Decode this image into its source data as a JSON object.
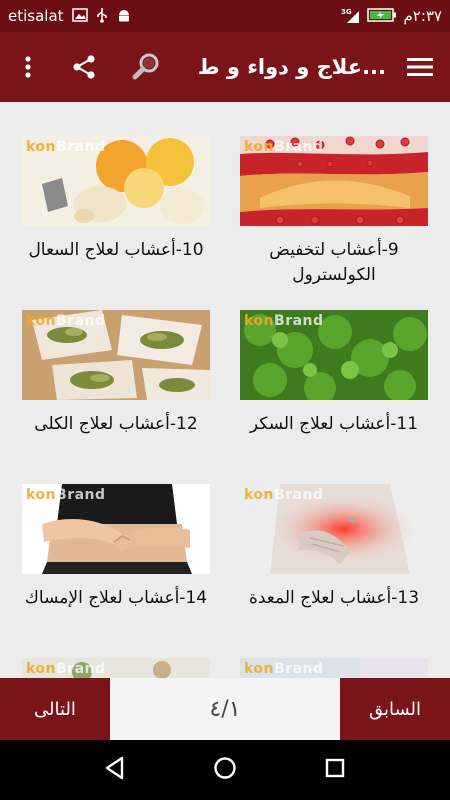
{
  "status_bar": {
    "carrier": "etisalat",
    "network": "3G",
    "time": "٢:٣٧م"
  },
  "app_bar": {
    "title": "علاج و دواء و ط..."
  },
  "items": [
    {
      "title": "9-أعشاب لتخفيض الكولسترول",
      "thumb": "cholesterol-artery"
    },
    {
      "title": "10-أعشاب لعلاج السعال",
      "thumb": "lemon-garlic"
    },
    {
      "title": "11-أعشاب لعلاج السكر",
      "thumb": "parsley"
    },
    {
      "title": "12-أعشاب لعلاج الكلى",
      "thumb": "dried-herbs"
    },
    {
      "title": "13-أعشاب لعلاج المعدة",
      "thumb": "stomach-pain"
    },
    {
      "title": "14-أعشاب لعلاج الإمساك",
      "thumb": "belly-hands"
    }
  ],
  "watermark": "konBrand",
  "bottom_bar": {
    "prev_label": "السابق",
    "next_label": "التالى",
    "page_indicator": "٤/١"
  },
  "colors": {
    "primary": "#7a1418",
    "status": "#6b0f15"
  }
}
